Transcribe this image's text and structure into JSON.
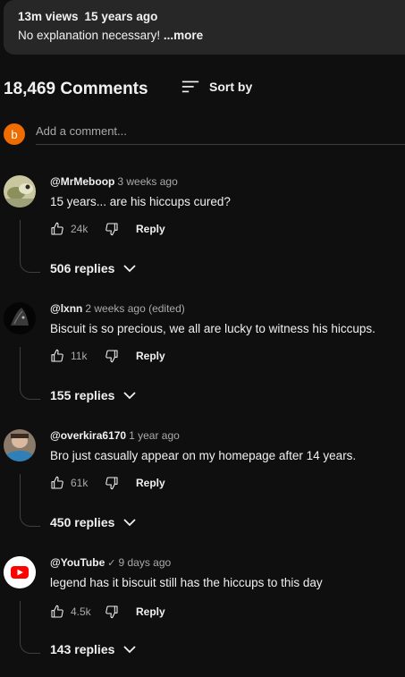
{
  "description": {
    "views": "13m views",
    "age": "15 years ago",
    "text": "No explanation necessary!",
    "more_label": "...more"
  },
  "comments_header": {
    "count": "18,469 Comments",
    "sort_label": "Sort by",
    "sort_icon": "sort-icon"
  },
  "add_comment": {
    "avatar_letter": "b",
    "avatar_color": "#ef6c00",
    "placeholder": "Add a comment..."
  },
  "comments": [
    {
      "author": "@MrMeboop",
      "time": "3 weeks ago",
      "text": "15 years...  are his hiccups cured?",
      "likes": "24k",
      "reply_label": "Reply",
      "replies_label": "506 replies"
    },
    {
      "author": "@lxnn",
      "time": "2 weeks ago (edited)",
      "text": "Biscuit is so precious, we all are lucky to witness his hiccups.",
      "likes": "11k",
      "reply_label": "Reply",
      "replies_label": "155 replies"
    },
    {
      "author": "@overkira6170",
      "time": "1 year ago",
      "text": "Bro just casually appear on my homepage after 14 years.",
      "likes": "61k",
      "reply_label": "Reply",
      "replies_label": "450 replies"
    },
    {
      "author": "@YouTube",
      "verified": "✓",
      "time": "9 days ago",
      "text": "legend has it biscuit still has the hiccups to this day",
      "likes": "4.5k",
      "reply_label": "Reply",
      "replies_label": "143 replies"
    }
  ],
  "colors": {
    "background": "#0f0f0f",
    "description_bg": "#272727",
    "secondary_text": "#aaaaaa",
    "youtube_red": "#ff0000"
  }
}
